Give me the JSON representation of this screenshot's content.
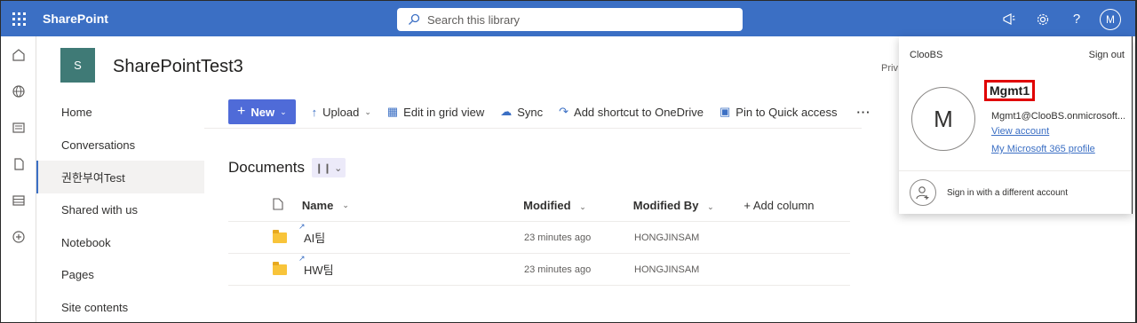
{
  "app": {
    "brand": "SharePoint"
  },
  "search": {
    "placeholder": "Search this library"
  },
  "topbar": {
    "avatar_initial": "M"
  },
  "site": {
    "logo_letter": "S",
    "title": "SharePointTest3"
  },
  "nav": {
    "items": [
      {
        "label": "Home"
      },
      {
        "label": "Conversations"
      },
      {
        "label": "권한부여Test"
      },
      {
        "label": "Shared with us"
      },
      {
        "label": "Notebook"
      },
      {
        "label": "Pages"
      },
      {
        "label": "Site contents"
      }
    ],
    "selected_index": 2
  },
  "commands": {
    "new": "New",
    "upload": "Upload",
    "grid": "Edit in grid view",
    "sync": "Sync",
    "shortcut": "Add shortcut to OneDrive",
    "pin": "Pin to Quick access",
    "more": "···"
  },
  "library": {
    "title": "Documents"
  },
  "table": {
    "headers": {
      "name": "Name",
      "modified": "Modified",
      "modified_by": "Modified By",
      "add_column": "+ Add column"
    },
    "rows": [
      {
        "name": "AI팀",
        "modified": "23 minutes ago",
        "modified_by": "HONGJINSAM"
      },
      {
        "name": "HW팀",
        "modified": "23 minutes ago",
        "modified_by": "HONGJINSAM"
      }
    ]
  },
  "privacy_fragment": "Priv",
  "account_panel": {
    "org": "ClooBS",
    "sign_out": "Sign out",
    "avatar_initial": "M",
    "name": "Mgmt1",
    "email": "Mgmt1@ClooBS.onmicrosoft....",
    "view_account": "View account",
    "profile": "My Microsoft 365 profile",
    "different_account": "Sign in with a different account"
  },
  "colors": {
    "suite_bar": "#3b6fc4",
    "accent": "#4f6bd8",
    "highlight": "#e00000",
    "site_logo": "#3f7a76"
  }
}
